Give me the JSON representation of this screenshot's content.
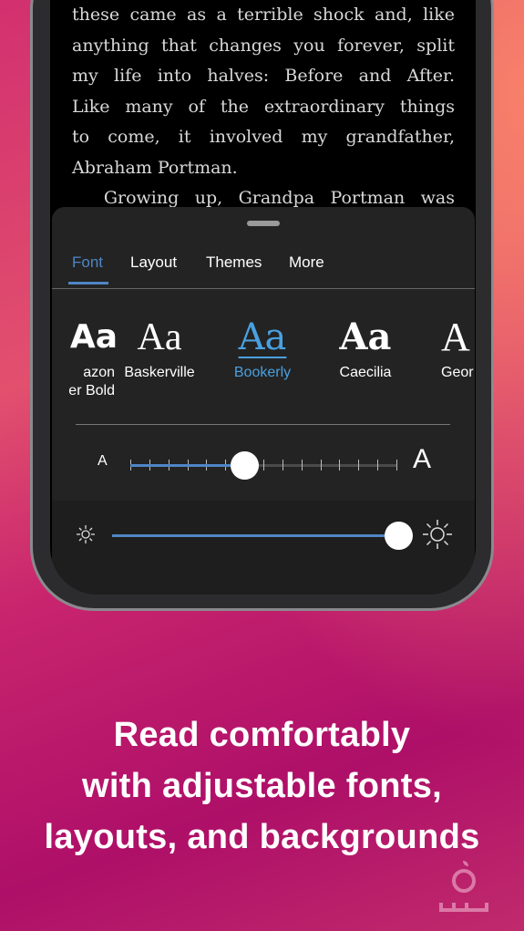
{
  "reader": {
    "lines": [
      "these came as a terrible shock and, like",
      "anything that changes you forever, split",
      "my life into halves: Before and After.",
      "Like many of the extraordinary things",
      "to come, it involved my grandfather,",
      "Abraham Portman.",
      "  Growing up, Grandpa Portman was"
    ]
  },
  "tabs": [
    {
      "label": "Font",
      "active": true
    },
    {
      "label": "Layout"
    },
    {
      "label": "Themes"
    },
    {
      "label": "More"
    }
  ],
  "fonts": [
    {
      "sample": "Aa",
      "label": "Amazon Ember Bold",
      "shown_label": "azon\ner Bold"
    },
    {
      "sample": "Aa",
      "label": "Baskerville"
    },
    {
      "sample": "Aa",
      "label": "Bookerly",
      "selected": true
    },
    {
      "sample": "Aa",
      "label": "Caecilia"
    },
    {
      "sample": "A",
      "label": "Geor"
    }
  ],
  "font_size": {
    "small_label": "A",
    "large_label": "A",
    "level": 6,
    "steps": 14
  },
  "brightness": {
    "level_percent": 100,
    "low_icon": "sun-small-icon",
    "high_icon": "sun-large-icon"
  },
  "caption": {
    "line1": "Read comfortably",
    "line2": "with adjustable fonts,",
    "line3": "layouts, and backgrounds"
  },
  "colors": {
    "accent": "#4f86c6",
    "panel": "#232323"
  }
}
